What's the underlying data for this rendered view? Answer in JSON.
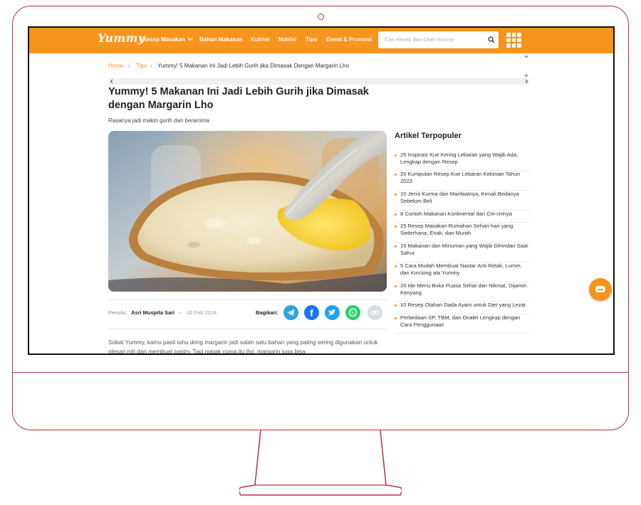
{
  "colors": {
    "brand": "#f7941d",
    "frame": "#b8323a"
  },
  "header": {
    "logo": "Yummy",
    "nav": [
      "Resep Masakan",
      "Bahan Makanan",
      "Kuliner",
      "Nutrisi",
      "Tips",
      "Event & Promosi"
    ],
    "search_placeholder": "Cari Resep dan Chef Yummy"
  },
  "breadcrumb": {
    "home": "Home",
    "tips": "Tips",
    "current": "Yummy! 5 Makanan Ini Jadi Lebih Gurih jika Dimasak Dengan Margarin Lho"
  },
  "article": {
    "title": "Yummy! 5 Makanan Ini Jadi Lebih Gurih jika Dimasak dengan Margarin Lho",
    "subtitle": "Rasanya jadi makin gurih dan beraroma",
    "author_label": "Penulis:",
    "author": "Asri Muspita Sari",
    "date": "02 Feb 2024",
    "share_label": "Bagikan:",
    "body": "Sobat Yummy, kamu pasti tahu dong margarin jadi salah satu bahan yang paling sering digunakan untuk olesan roti dan membuat pastry. Tapi nggak cuma itu lho, margarin juga bisa"
  },
  "sidebar": {
    "title": "Artikel Terpopuler",
    "items": [
      "25 Inspirasi Kue Kering Lebaran yang Wajib Ada, Lengkap dengan Resep",
      "20 Kumpulan Resep Kue Lebaran Kekinian Tahun 2023",
      "10 Jenis Kurma dan Manfaatnya, Kenali Bedanya Sebelum Beli",
      "8 Contoh Makanan Kontinental dan Ciri-cirinya",
      "25 Resep Masakan Rumahan Sehari-hari yang Sederhana, Enak, dan Murah",
      "15 Makanan dan Minuman yang Wajib Dihindari Saat Sahur",
      "5 Cara Mudah Membuat Nastar Anti Retak, Lumer, dan Kinclong ala Yummy",
      "20 Ide Menu Buka Puasa Sehat dan Nikmat, Dijamin Kenyang",
      "10 Resep Olahan Dada Ayam untuk Diet yang Lezat",
      "Perbedaan SP, TBM, dan Ovalet Lengkap dengan Cara Penggunaan"
    ]
  }
}
